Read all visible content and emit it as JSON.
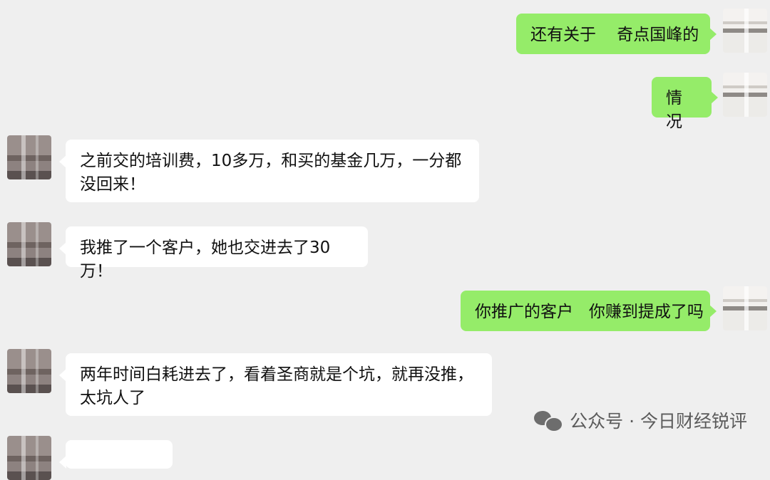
{
  "messages": [
    {
      "side": "out",
      "text": "还有关于    奇点国峰的"
    },
    {
      "side": "out",
      "text": "情况"
    },
    {
      "side": "in",
      "text": "之前交的培训费，10多万，和买的基金几万，一分都没回来！"
    },
    {
      "side": "in",
      "text": "我推了一个客户，她也交进去了30万！"
    },
    {
      "side": "out",
      "text": "你推广的客户   你赚到提成了吗"
    },
    {
      "side": "in",
      "text": "两年时间白耗进去了，看着圣商就是个坑，就再没推，太坑人了"
    },
    {
      "side": "in",
      "text": ""
    }
  ],
  "watermark": {
    "icon": "wechat-icon",
    "text": "公众号 · 今日财经锐评"
  },
  "colors": {
    "background": "#efefef",
    "outgoing_bubble": "#95ec69",
    "incoming_bubble": "#ffffff"
  }
}
